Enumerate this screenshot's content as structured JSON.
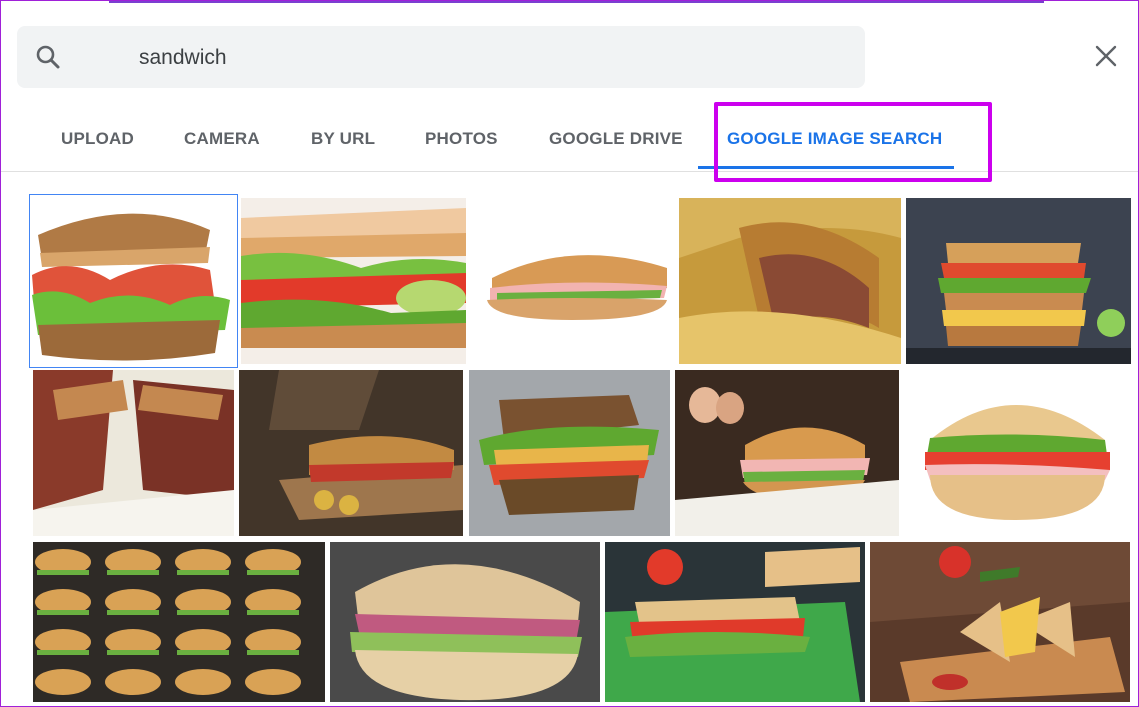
{
  "search": {
    "value": "sandwich",
    "search_icon": "search-icon",
    "close_icon": "close-icon"
  },
  "tabs": [
    {
      "label": "UPLOAD"
    },
    {
      "label": "CAMERA"
    },
    {
      "label": "BY URL"
    },
    {
      "label": "PHOTOS"
    },
    {
      "label": "GOOGLE DRIVE"
    },
    {
      "label": "GOOGLE IMAGE SEARCH",
      "active": true
    }
  ],
  "colors": {
    "accent": "#1a73e8",
    "highlight": "#cc00ee",
    "tab_text": "#5f6368",
    "search_bg": "#f1f3f4"
  },
  "results": {
    "rows": [
      {
        "items": [
          "blt-sandwich",
          "toast-sandwich-cucumber",
          "ham-sub-roll",
          "pastry-sandwich",
          "stacked-club-sandwich"
        ]
      },
      {
        "items": [
          "grilled-bacon-sandwich",
          "sub-on-board",
          "bread-sandwich-lettuce",
          "burger-with-eggs",
          "seeded-bun-sandwich"
        ]
      },
      {
        "items": [
          "tray-of-sandwiches",
          "ciabatta-sandwich",
          "sandwich-on-napkin",
          "club-sandwich-fries"
        ]
      }
    ],
    "selected_index": 0
  }
}
